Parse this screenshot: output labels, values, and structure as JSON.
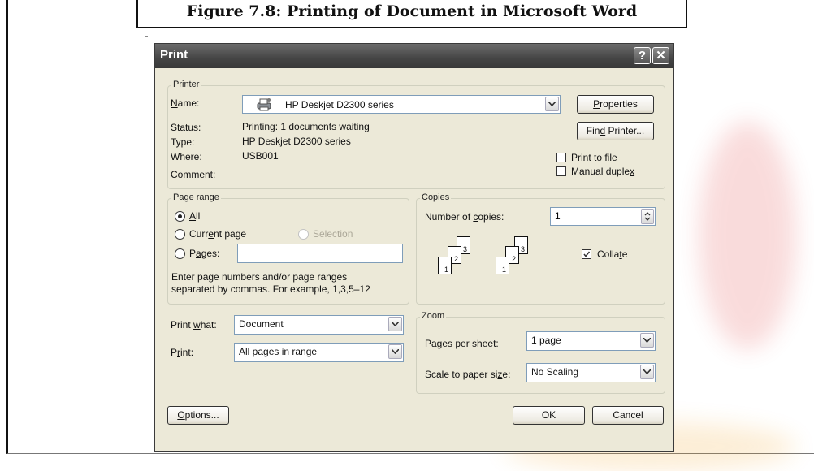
{
  "figure_caption": "Figure 7.8: Printing of Document in Microsoft Word",
  "dialog": {
    "title": "Print",
    "help_icon": "help-icon",
    "close_icon": "close-icon",
    "printer": {
      "legend": "Printer",
      "name_label": "Name:",
      "name_value": "HP Deskjet D2300 series",
      "status_label": "Status:",
      "status_value": "Printing: 1 documents waiting",
      "type_label": "Type:",
      "type_value": "HP Deskjet D2300 series",
      "where_label": "Where:",
      "where_value": "USB001",
      "comment_label": "Comment:",
      "properties_button": "Properties",
      "find_printer_button": "Find Printer...",
      "print_to_file_label": "Print to file",
      "print_to_file_checked": false,
      "manual_duplex_label": "Manual duplex",
      "manual_duplex_checked": false
    },
    "page_range": {
      "legend": "Page range",
      "all_label": "All",
      "current_page_label": "Current page",
      "selection_label": "Selection",
      "pages_label": "Pages:",
      "pages_value": "",
      "selected": "All",
      "hint_line1": "Enter page numbers and/or page ranges",
      "hint_line2": "separated by commas.  For example, 1,3,5–12"
    },
    "copies": {
      "legend": "Copies",
      "number_label": "Number of copies:",
      "number_value": "1",
      "collate_label": "Collate",
      "collate_checked": true,
      "page_numbers": [
        "3",
        "2",
        "1"
      ]
    },
    "print_what_label": "Print what:",
    "print_what_value": "Document",
    "print_label": "Print:",
    "print_value": "All pages in range",
    "zoom": {
      "legend": "Zoom",
      "pages_per_sheet_label": "Pages per sheet:",
      "pages_per_sheet_value": "1 page",
      "scale_label": "Scale to paper size:",
      "scale_value": "No Scaling"
    },
    "options_button": "Options...",
    "ok_button": "OK",
    "cancel_button": "Cancel"
  }
}
